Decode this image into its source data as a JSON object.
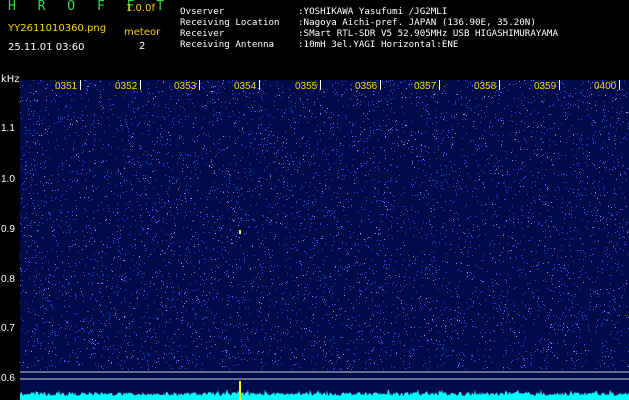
{
  "header": {
    "app_title": "H R O F F T",
    "app_version": "1.0.0f",
    "file_name": "YY2611010360.png",
    "timestamp": "25.11.01 03:60",
    "meteor_label": "meteor",
    "meteor_count": "2"
  },
  "info": [
    {
      "key": "Ovserver",
      "value": ":YOSHIKAWA Yasufumi /JG2MLI"
    },
    {
      "key": "Receiving Location",
      "value": ":Nagoya Aichi-pref. JAPAN (136.90E, 35.20N)"
    },
    {
      "key": "Receiver",
      "value": ":SMart RTL-SDR V5 52.905MHz USB HIGASHIMURAYAMA"
    },
    {
      "key": "Receiving Antenna",
      "value": ":10mH 3el.YAGI Horizontal:ENE"
    }
  ],
  "axis": {
    "y_unit": "kHz",
    "y_ticks": [
      "1.1",
      "1.0",
      "0.9",
      "0.8",
      "0.7",
      "0.6"
    ],
    "x_ticks": [
      "0351",
      "0352",
      "0353",
      "0354",
      "0355",
      "0356",
      "0357",
      "0358",
      "0359",
      "0400"
    ]
  },
  "colors": {
    "background": "#000c4a",
    "noise": "#3a4cff",
    "signal": "#00ffff",
    "meteor": "#ffff00",
    "label_yellow": "#ffd200",
    "title_green": "#38d84a"
  },
  "meteor_events": [
    {
      "time": "0354",
      "freq_khz": 0.9
    }
  ]
}
